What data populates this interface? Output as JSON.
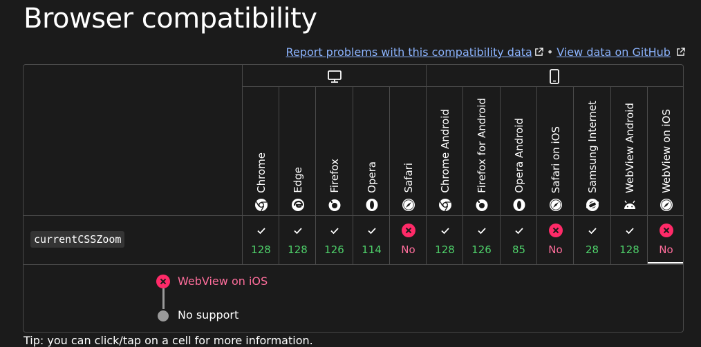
{
  "title": "Browser compatibility",
  "report_link": "Report problems with this compatibility data",
  "separator": "•",
  "github_link": "View data on GitHub",
  "feature_name": "currentCSSZoom",
  "groups": [
    {
      "name": "desktop",
      "icon": "desktop-icon"
    },
    {
      "name": "mobile",
      "icon": "mobile-icon"
    }
  ],
  "browsers": [
    {
      "name": "Chrome",
      "icon": "chrome-icon",
      "support": "yes",
      "version": "128"
    },
    {
      "name": "Edge",
      "icon": "edge-icon",
      "support": "yes",
      "version": "128"
    },
    {
      "name": "Firefox",
      "icon": "firefox-icon",
      "support": "yes",
      "version": "126"
    },
    {
      "name": "Opera",
      "icon": "opera-icon",
      "support": "yes",
      "version": "114"
    },
    {
      "name": "Safari",
      "icon": "safari-icon",
      "support": "no",
      "version": "No"
    },
    {
      "name": "Chrome Android",
      "icon": "chrome-icon",
      "support": "yes",
      "version": "128"
    },
    {
      "name": "Firefox for Android",
      "icon": "firefox-icon",
      "support": "yes",
      "version": "126"
    },
    {
      "name": "Opera Android",
      "icon": "opera-icon",
      "support": "yes",
      "version": "85"
    },
    {
      "name": "Safari on iOS",
      "icon": "safari-icon",
      "support": "no",
      "version": "No"
    },
    {
      "name": "Samsung Internet",
      "icon": "samsung-internet-icon",
      "support": "yes",
      "version": "28"
    },
    {
      "name": "WebView Android",
      "icon": "android-icon",
      "support": "yes",
      "version": "128"
    },
    {
      "name": "WebView on iOS",
      "icon": "safari-icon",
      "support": "no",
      "version": "No"
    }
  ],
  "legend": {
    "browser": "WebView on iOS",
    "support_label": "No support"
  },
  "footer_text": "Tip: you can click/tap on a cell for more information.",
  "colors": {
    "background": "#1b1b1b",
    "supported": "#4ed16a",
    "unsupported": "#ff6e9c",
    "link": "#8cb4ff",
    "border": "#4a4a4a"
  }
}
